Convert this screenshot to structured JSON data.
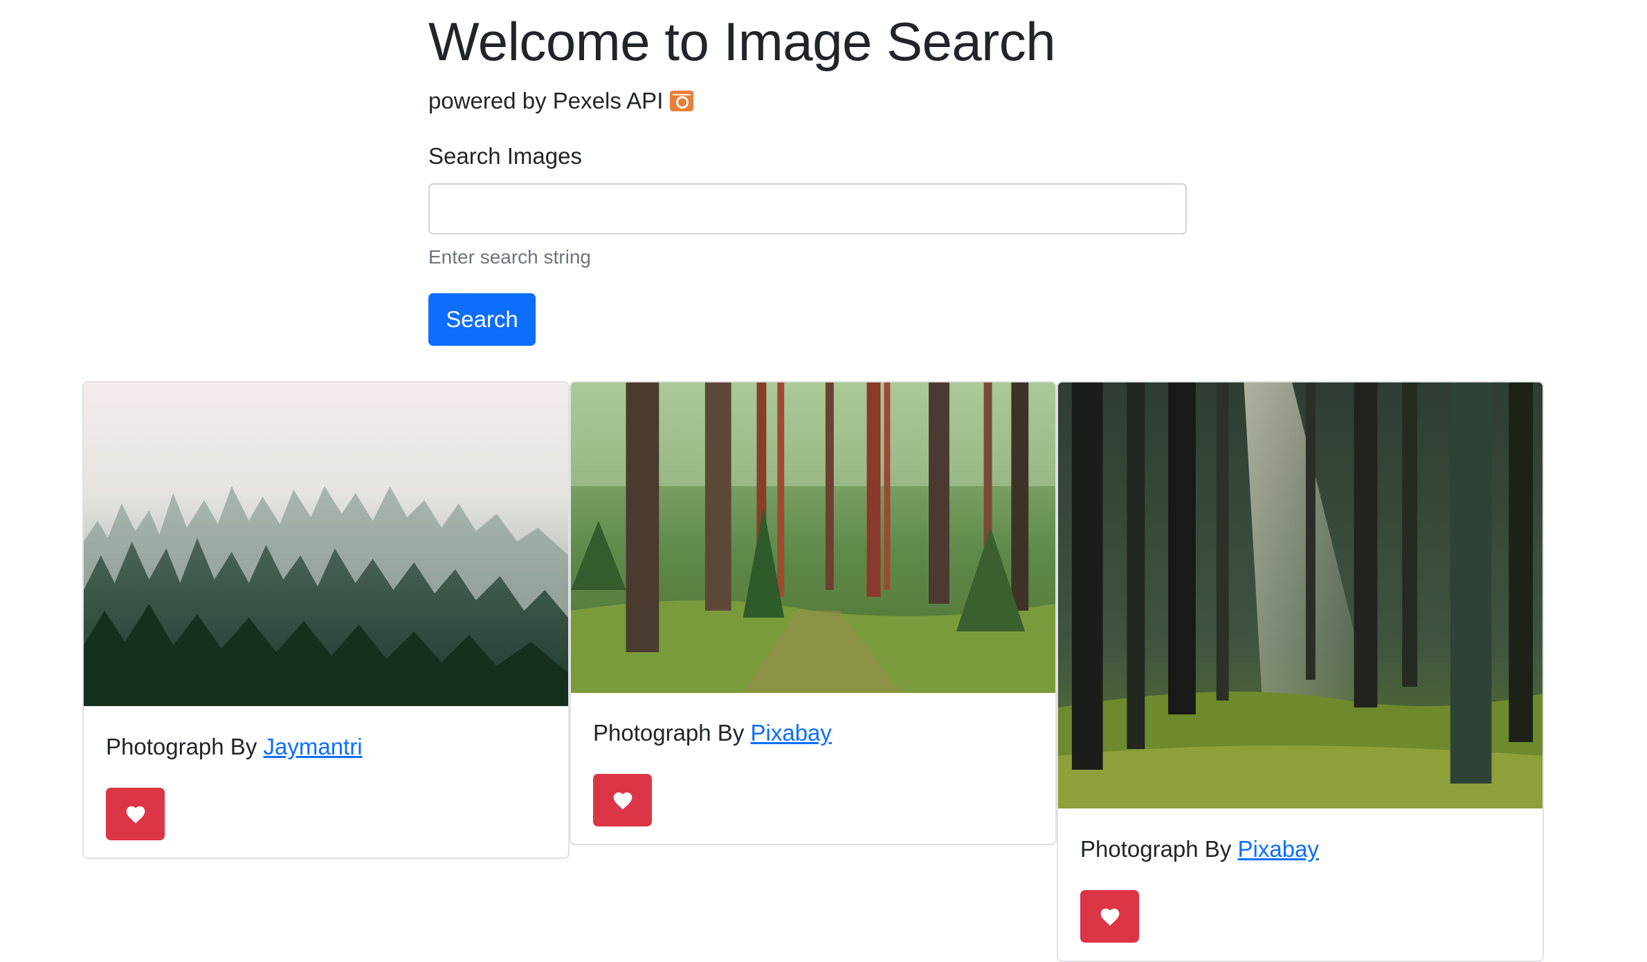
{
  "header": {
    "title": "Welcome to Image Search",
    "powered_by": "powered by Pexels API"
  },
  "search": {
    "label": "Search Images",
    "value": "",
    "placeholder": "",
    "help_text": "Enter search string",
    "button_label": "Search"
  },
  "cards": [
    {
      "image": "misty pine forest",
      "credit_prefix": "Photograph By",
      "photographer": "Jaymantri",
      "like_icon": "heart-icon"
    },
    {
      "image": "forest path with trees",
      "credit_prefix": "Photograph By",
      "photographer": "Pixabay",
      "like_icon": "heart-icon"
    },
    {
      "image": "sunlit dark forest",
      "credit_prefix": "Photograph By",
      "photographer": "Pixabay",
      "like_icon": "heart-icon"
    }
  ],
  "colors": {
    "primary": "#0d6efd",
    "danger": "#dc3545",
    "muted": "#6c757d",
    "pexels": "#e8803a"
  }
}
